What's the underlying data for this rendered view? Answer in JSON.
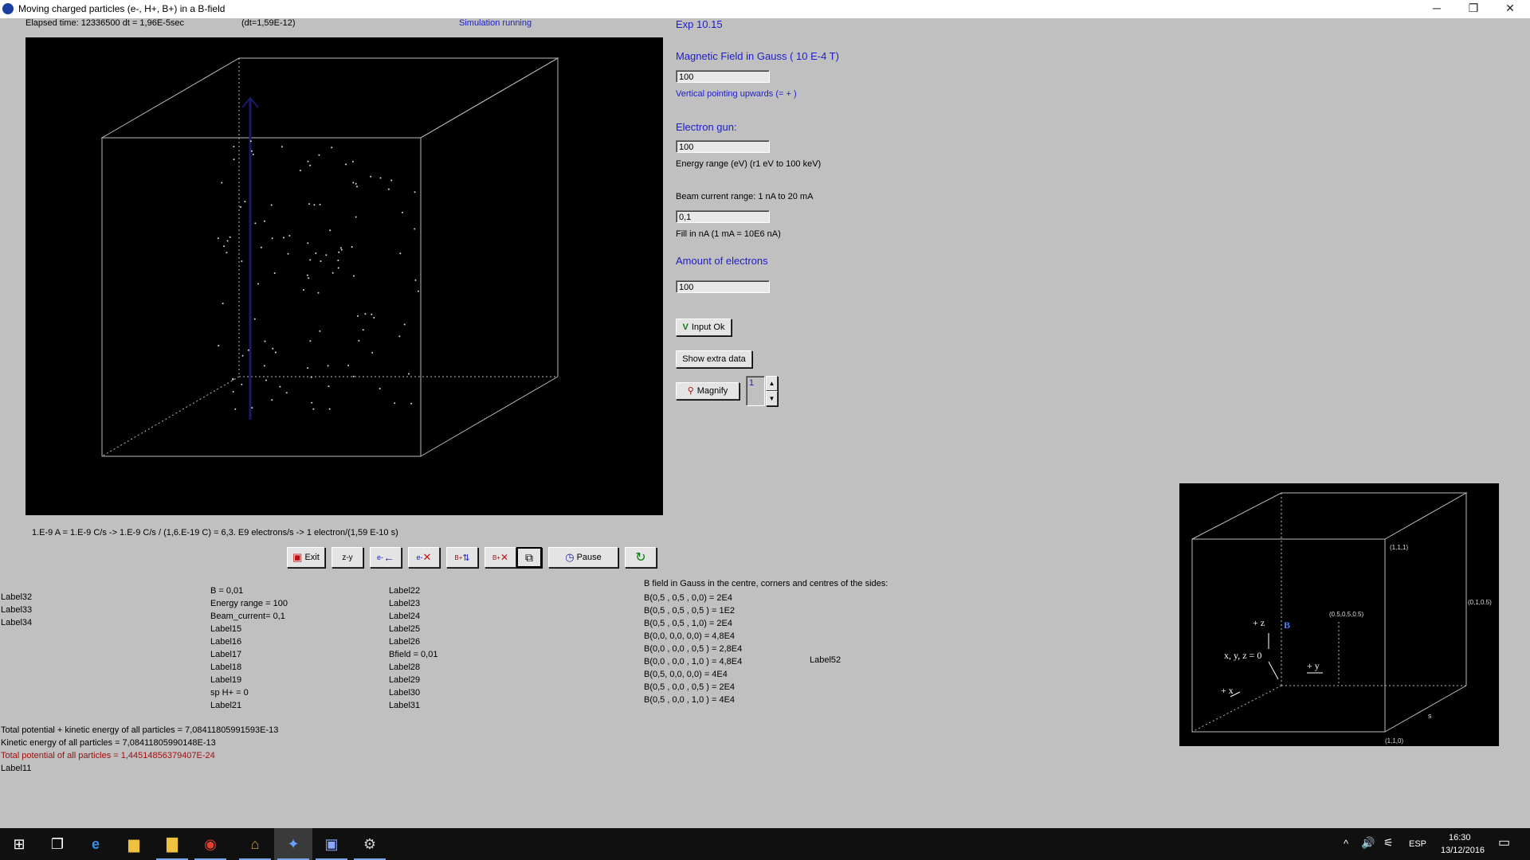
{
  "window": {
    "title": "Moving charged particles (e-, H+, B+) in a B-field",
    "controls": {
      "minimize": "─",
      "restore": "❐",
      "close": "✕"
    }
  },
  "status": {
    "elapsed": "Elapsed time: 12336500 dt  = 1,96E-5sec",
    "dt": "(dt=1,59E-12)",
    "running": "Simulation running"
  },
  "panel": {
    "exp": "Exp 10.15",
    "magnetic_title": "Magnetic Field in Gauss ( 10 E-4 T)",
    "magnetic_value": "100",
    "magnetic_note": "Vertical pointing upwards (= + )",
    "gun_title": "Electron gun:",
    "gun_value": "100",
    "energy_range": "Energy range (eV)     (r1 eV to 100 keV)",
    "beam_range": "Beam current range: 1 nA to 20 mA",
    "beam_value": "0,1",
    "beam_note": "Fill in nA (1 mA = 10E6 nA)",
    "amount_title": "Amount of electrons",
    "amount_value": "100",
    "input_ok": "Input Ok",
    "show_extra": "Show extra data",
    "magnify": "Magnify",
    "magnify_value": "1"
  },
  "formula": "1.E-9 A = 1.E-9 C/s  ->  1.E-9 C/s / (1,6.E-19 C) = 6,3. E9   electrons/s  -> 1 electron/(1,59 E-10 s)",
  "toolbar": {
    "exit": "Exit",
    "axis_icon": "z-y",
    "electron_left": "e-",
    "electron_remove": "e-",
    "add_ions": "B+",
    "remove_ions": "B+",
    "pause": "Pause"
  },
  "labels_col1": [
    "Label32",
    "Label33",
    "Label34"
  ],
  "labels_col2": [
    "B = 0,01",
    "Energy range = 100",
    "Beam_current= 0,1",
    "Label15",
    "Label16",
    "Label17",
    "Label18",
    "Label19",
    "sp H+ =  0",
    "Label21"
  ],
  "labels_col3": [
    "Label22",
    "Label23",
    "Label24",
    "Label25",
    "Label26",
    "Bfield = 0,01",
    "Label28",
    "Label29",
    "Label30",
    "Label31"
  ],
  "bfield": {
    "title": "B field in Gauss in the centre, corners and centres of the sides:",
    "values": [
      "B(0,5 , 0,5 , 0,0) = 2E4",
      "B(0,5 , 0,5 , 0,5 ) = 1E2",
      "B(0,5 , 0,5 , 1,0) = 2E4",
      "B(0,0, 0,0, 0,0) = 4,8E4",
      "B(0,0 , 0,0 , 0,5 ) = 2,8E4",
      "B(0,0 , 0,0 , 1,0 ) = 4,8E4",
      "B(0,5, 0,0, 0,0) = 4E4",
      "B(0,5 , 0,0 , 0,5 ) = 2E4",
      "B(0,5 , 0,0 , 1,0 ) = 4E4"
    ],
    "label52": "Label52"
  },
  "energy": {
    "total": "Total potential + kinetic energy of all particles = 7,08411805991593E-13",
    "kinetic": "Kinetic energy of all particles = 7,08411805990148E-13",
    "potential": "Total potential of all particles = 1,44514856379407E-24",
    "label11": "Label11"
  },
  "axes_view": {
    "c111": "(1,1,1)",
    "c010_5": "(0,1,0.5)",
    "c_center": "(0.5,0.5,0.5)",
    "plus_z": "+ z",
    "b": "B",
    "origin": "x, y, z = 0",
    "plus_y": "+ y",
    "plus_x": "+ x",
    "s": "s",
    "c110": "(1,1,0)"
  },
  "tray": {
    "lang": "ESP",
    "time": "16:30",
    "date": "13/12/2016"
  },
  "colors": {
    "accent_blue": "#1e1ec8",
    "potential_red": "#a01010",
    "client_bg": "#c0c0c0"
  }
}
